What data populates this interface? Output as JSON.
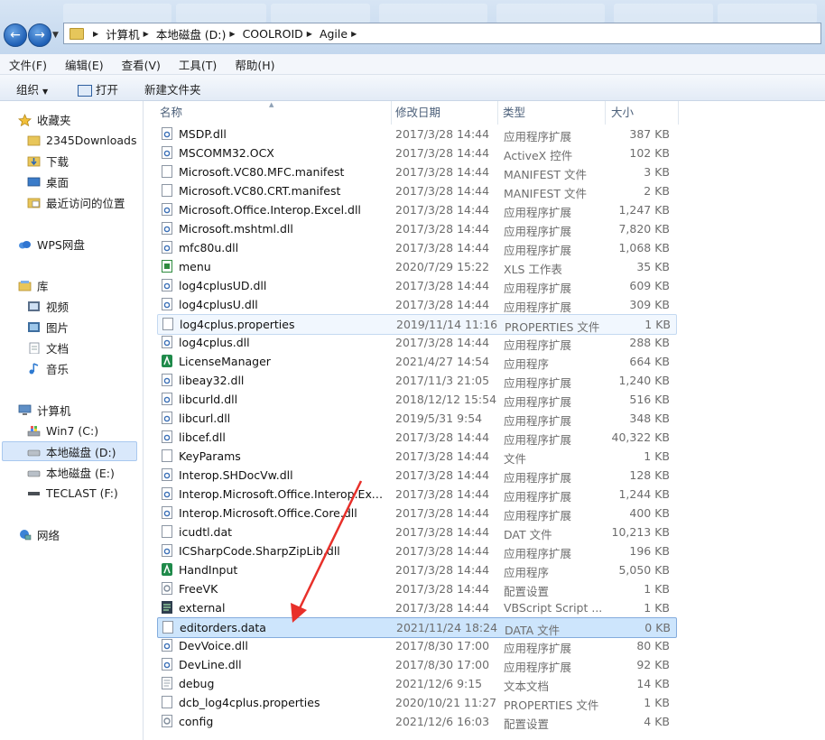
{
  "breadcrumb": [
    "计算机",
    "本地磁盘 (D:)",
    "COOLROID",
    "Agile"
  ],
  "menu": [
    "文件(F)",
    "编辑(E)",
    "查看(V)",
    "工具(T)",
    "帮助(H)"
  ],
  "toolbar": {
    "organize": "组织",
    "open": "打开",
    "new_folder": "新建文件夹"
  },
  "sidebar": {
    "favorites": "收藏夹",
    "fav_items": [
      "2345Downloads",
      "下载",
      "桌面",
      "最近访问的位置"
    ],
    "wps": "WPS网盘",
    "libraries": "库",
    "lib_items": [
      "视频",
      "图片",
      "文档",
      "音乐"
    ],
    "computer": "计算机",
    "drives": [
      "Win7 (C:)",
      "本地磁盘 (D:)",
      "本地磁盘 (E:)",
      "TECLAST (F:)"
    ],
    "network": "网络"
  },
  "columns": {
    "name": "名称",
    "date": "修改日期",
    "type": "类型",
    "size": "大小"
  },
  "files": [
    {
      "name": "MSDP.dll",
      "date": "2017/3/28 14:44",
      "type": "应用程序扩展",
      "size": "387 KB",
      "icon": "dll-icon"
    },
    {
      "name": "MSCOMM32.OCX",
      "date": "2017/3/28 14:44",
      "type": "ActiveX 控件",
      "size": "102 KB",
      "icon": "dll-icon"
    },
    {
      "name": "Microsoft.VC80.MFC.manifest",
      "date": "2017/3/28 14:44",
      "type": "MANIFEST 文件",
      "size": "3 KB",
      "icon": "file-icon"
    },
    {
      "name": "Microsoft.VC80.CRT.manifest",
      "date": "2017/3/28 14:44",
      "type": "MANIFEST 文件",
      "size": "2 KB",
      "icon": "file-icon"
    },
    {
      "name": "Microsoft.Office.Interop.Excel.dll",
      "date": "2017/3/28 14:44",
      "type": "应用程序扩展",
      "size": "1,247 KB",
      "icon": "dll-icon"
    },
    {
      "name": "Microsoft.mshtml.dll",
      "date": "2017/3/28 14:44",
      "type": "应用程序扩展",
      "size": "7,820 KB",
      "icon": "dll-icon"
    },
    {
      "name": "mfc80u.dll",
      "date": "2017/3/28 14:44",
      "type": "应用程序扩展",
      "size": "1,068 KB",
      "icon": "dll-icon"
    },
    {
      "name": "menu",
      "date": "2020/7/29 15:22",
      "type": "XLS 工作表",
      "size": "35 KB",
      "icon": "xls-icon"
    },
    {
      "name": "log4cplusUD.dll",
      "date": "2017/3/28 14:44",
      "type": "应用程序扩展",
      "size": "609 KB",
      "icon": "dll-icon"
    },
    {
      "name": "log4cplusU.dll",
      "date": "2017/3/28 14:44",
      "type": "应用程序扩展",
      "size": "309 KB",
      "icon": "dll-icon"
    },
    {
      "name": "log4cplus.properties",
      "date": "2019/11/14 11:16",
      "type": "PROPERTIES 文件",
      "size": "1 KB",
      "icon": "file-icon",
      "state": "hover"
    },
    {
      "name": "log4cplus.dll",
      "date": "2017/3/28 14:44",
      "type": "应用程序扩展",
      "size": "288 KB",
      "icon": "dll-icon"
    },
    {
      "name": "LicenseManager",
      "date": "2021/4/27 14:54",
      "type": "应用程序",
      "size": "664 KB",
      "icon": "app-icon"
    },
    {
      "name": "libeay32.dll",
      "date": "2017/11/3 21:05",
      "type": "应用程序扩展",
      "size": "1,240 KB",
      "icon": "dll-icon"
    },
    {
      "name": "libcurld.dll",
      "date": "2018/12/12 15:54",
      "type": "应用程序扩展",
      "size": "516 KB",
      "icon": "dll-icon"
    },
    {
      "name": "libcurl.dll",
      "date": "2019/5/31 9:54",
      "type": "应用程序扩展",
      "size": "348 KB",
      "icon": "dll-icon"
    },
    {
      "name": "libcef.dll",
      "date": "2017/3/28 14:44",
      "type": "应用程序扩展",
      "size": "40,322 KB",
      "icon": "dll-icon"
    },
    {
      "name": "KeyParams",
      "date": "2017/3/28 14:44",
      "type": "文件",
      "size": "1 KB",
      "icon": "file-icon"
    },
    {
      "name": "Interop.SHDocVw.dll",
      "date": "2017/3/28 14:44",
      "type": "应用程序扩展",
      "size": "128 KB",
      "icon": "dll-icon"
    },
    {
      "name": "Interop.Microsoft.Office.Interop.Excel...",
      "date": "2017/3/28 14:44",
      "type": "应用程序扩展",
      "size": "1,244 KB",
      "icon": "dll-icon"
    },
    {
      "name": "Interop.Microsoft.Office.Core.dll",
      "date": "2017/3/28 14:44",
      "type": "应用程序扩展",
      "size": "400 KB",
      "icon": "dll-icon"
    },
    {
      "name": "icudtl.dat",
      "date": "2017/3/28 14:44",
      "type": "DAT 文件",
      "size": "10,213 KB",
      "icon": "file-icon"
    },
    {
      "name": "ICSharpCode.SharpZipLib.dll",
      "date": "2017/3/28 14:44",
      "type": "应用程序扩展",
      "size": "196 KB",
      "icon": "dll-icon"
    },
    {
      "name": "HandInput",
      "date": "2017/3/28 14:44",
      "type": "应用程序",
      "size": "5,050 KB",
      "icon": "app-icon"
    },
    {
      "name": "FreeVK",
      "date": "2017/3/28 14:44",
      "type": "配置设置",
      "size": "1 KB",
      "icon": "config-icon"
    },
    {
      "name": "external",
      "date": "2017/3/28 14:44",
      "type": "VBScript Script ...",
      "size": "1 KB",
      "icon": "script-icon"
    },
    {
      "name": "editorders.data",
      "date": "2021/11/24 18:24",
      "type": "DATA 文件",
      "size": "0 KB",
      "icon": "file-icon",
      "state": "selected"
    },
    {
      "name": "DevVoice.dll",
      "date": "2017/8/30 17:00",
      "type": "应用程序扩展",
      "size": "80 KB",
      "icon": "dll-icon"
    },
    {
      "name": "DevLine.dll",
      "date": "2017/8/30 17:00",
      "type": "应用程序扩展",
      "size": "92 KB",
      "icon": "dll-icon"
    },
    {
      "name": "debug",
      "date": "2021/12/6 9:15",
      "type": "文本文档",
      "size": "14 KB",
      "icon": "text-icon"
    },
    {
      "name": "dcb_log4cplus.properties",
      "date": "2020/10/21 11:27",
      "type": "PROPERTIES 文件",
      "size": "1 KB",
      "icon": "file-icon"
    },
    {
      "name": "config",
      "date": "2021/12/6 16:03",
      "type": "配置设置",
      "size": "4 KB",
      "icon": "config-icon"
    }
  ],
  "colors": {
    "selection": "#cde5fc",
    "annotation_arrow": "#e8302a"
  }
}
